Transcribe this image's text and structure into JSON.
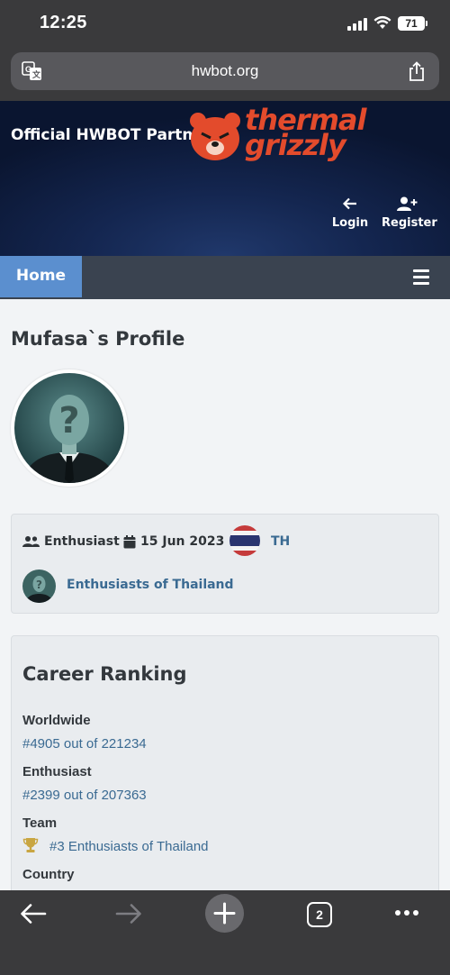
{
  "status_bar": {
    "time": "12:25",
    "battery": "71"
  },
  "browser": {
    "url": "hwbot.org",
    "tab_count": "2"
  },
  "banner": {
    "partner_text": "Official HWBOT Partner",
    "brand_line1": "thermal",
    "brand_line2": "grizzly",
    "login_label": "Login",
    "register_label": "Register"
  },
  "nav": {
    "home_label": "Home"
  },
  "profile": {
    "title": "Mufasa`s Profile",
    "role": "Enthusiast",
    "joined": "15 Jun 2023",
    "country_code": "TH",
    "team": "Enthusiasts of Thailand"
  },
  "career": {
    "title": "Career Ranking",
    "worldwide_label": "Worldwide",
    "worldwide_value": "#4905 out of 221234",
    "enthusiast_label": "Enthusiast",
    "enthusiast_value": "#2399 out of 207363",
    "team_label": "Team",
    "team_value": "#3 Enthusiasts of Thailand",
    "country_label": "Country"
  },
  "colors": {
    "brand_orange": "#e34b2c",
    "nav_bg": "#3a4350",
    "home_tab": "#5b8fcf",
    "link": "#3a6a92",
    "trophy": "#c9a642"
  }
}
